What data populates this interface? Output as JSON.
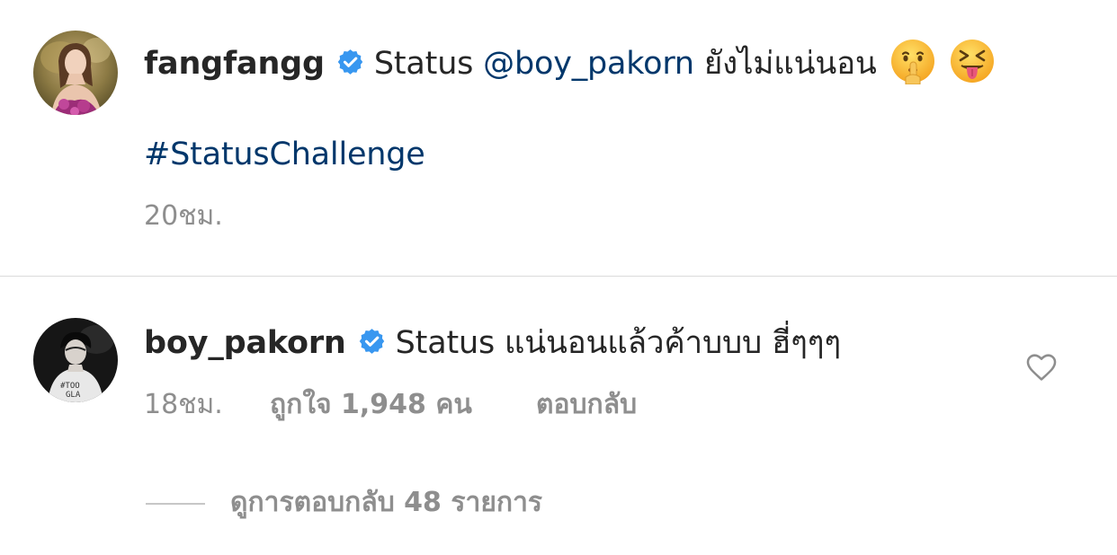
{
  "post": {
    "username": "fangfangg",
    "caption_text": "Status",
    "mention": "@boy_pakorn",
    "caption_rest": "ยังไม่แน่นอน",
    "emojis": [
      "shushing-face-emoji",
      "squinting-tongue-face-emoji"
    ],
    "hashtag": "#StatusChallenge",
    "timestamp": "20ชม."
  },
  "comment": {
    "username": "boy_pakorn",
    "text": "Status แน่นอนแล้วค้าบบบ ฮี่ๆๆๆ",
    "timestamp": "18ชม.",
    "likes": "ถูกใจ 1,948 คน",
    "reply_label": "ตอบกลับ",
    "view_replies": "ดูการตอบกลับ 48 รายการ"
  },
  "colors": {
    "text": "#262626",
    "link": "#00376b",
    "meta": "#8e8e8e",
    "verified": "#3897f0",
    "divider": "#dbdbdb"
  }
}
